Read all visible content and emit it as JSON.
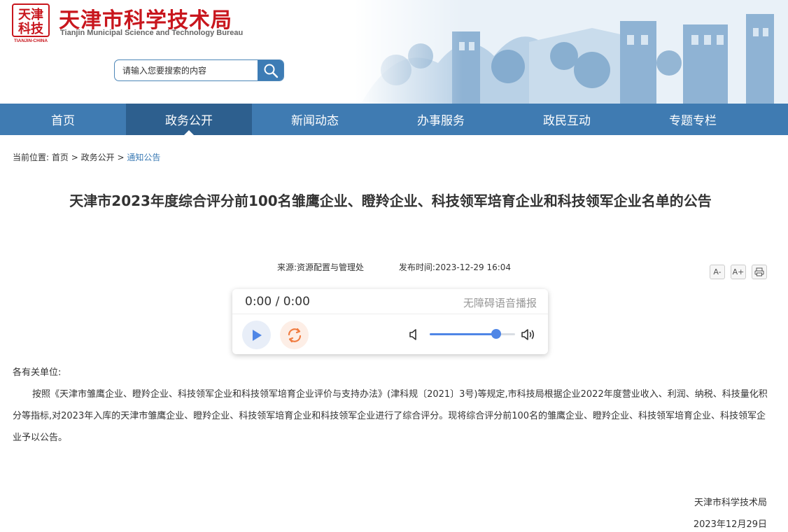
{
  "header": {
    "logo_text": [
      "天津",
      "科技",
      "TIANJIN-CHINA"
    ],
    "site_title": "天津市科学技术局",
    "site_subtitle": "Tianjin Municipal Science and Technology Bureau",
    "search_placeholder": "请输入您要搜索的内容",
    "search_icon": "search-icon"
  },
  "nav": {
    "items": [
      {
        "label": "首页"
      },
      {
        "label": "政务公开",
        "active": true
      },
      {
        "label": "新闻动态"
      },
      {
        "label": "办事服务"
      },
      {
        "label": "政民互动"
      },
      {
        "label": "专题专栏"
      }
    ]
  },
  "breadcrumb": {
    "prefix": "当前位置:",
    "items": [
      "首页",
      "政务公开",
      "通知公告"
    ],
    "separator": ">"
  },
  "article": {
    "title": "天津市2023年度综合评分前100名雏鹰企业、瞪羚企业、科技领军培育企业和科技领军企业名单的公告",
    "source": "来源:资源配置与管理处",
    "publish_time": "发布时间:2023-12-29 16:04",
    "greeting": "各有关单位:",
    "body": "按照《天津市雏鹰企业、瞪羚企业、科技领军企业和科技领军培育企业评价与支持办法》(津科规〔2021〕3号)等规定,市科技局根据企业2022年度营业收入、利润、纳税、科技量化积分等指标,对2023年入库的天津市雏鹰企业、瞪羚企业、科技领军培育企业和科技领军企业进行了综合评分。现将综合评分前100名的雏鹰企业、瞪羚企业、科技领军培育企业、科技领军企业予以公告。",
    "sign_org": "天津市科学技术局",
    "sign_date": "2023年12月29日"
  },
  "tools": {
    "font_decrease": "A-",
    "font_increase": "A+",
    "print_icon": "print-icon"
  },
  "player": {
    "time": "0:00 / 0:00",
    "label": "无障碍语音播报",
    "volume": 0.78
  },
  "colors": {
    "brand_red": "#c8161d",
    "nav_blue": "#3f7bb2",
    "nav_active": "#2d5f8e",
    "link_blue": "#3d7cb5",
    "player_accent": "#4f86e6"
  }
}
